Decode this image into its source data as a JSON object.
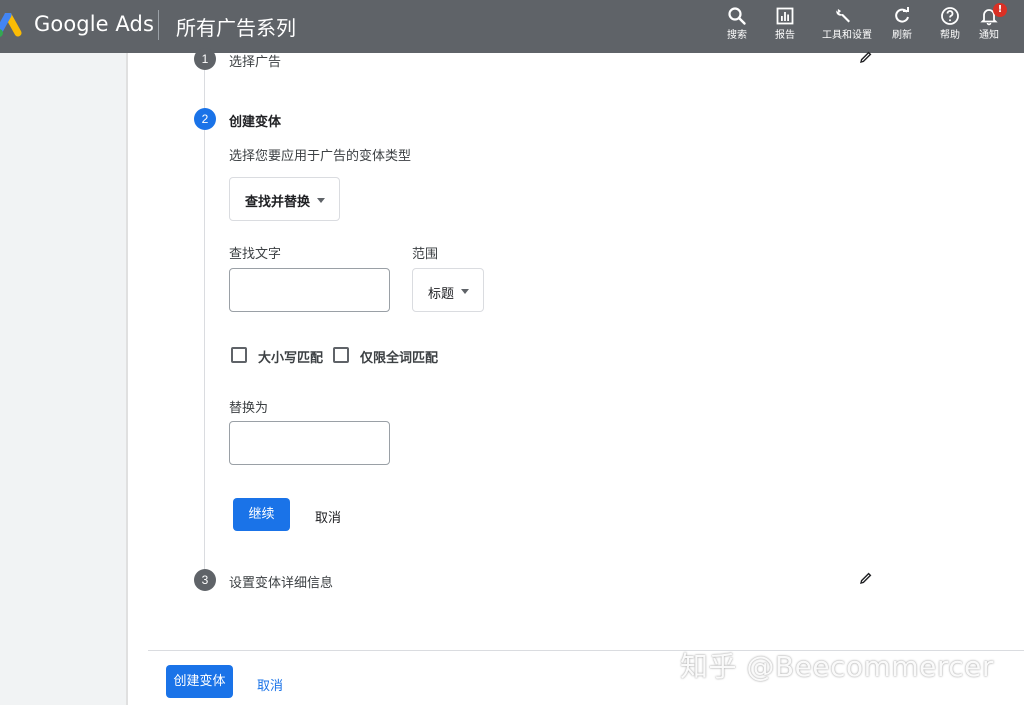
{
  "header": {
    "brand": "Google Ads",
    "title": "所有广告系列",
    "background_color": "#5f6368",
    "actions": [
      {
        "icon": "search-icon",
        "label": "搜索"
      },
      {
        "icon": "reports-icon",
        "label": "报告"
      },
      {
        "icon": "wrench-icon",
        "label": "工具和设置"
      },
      {
        "icon": "refresh-icon",
        "label": "刷新"
      },
      {
        "icon": "help-icon",
        "label": "帮助"
      },
      {
        "icon": "bell-icon",
        "label": "通知",
        "badge": "!"
      }
    ]
  },
  "stepper": {
    "steps": [
      {
        "number": "1",
        "title": "选择广告",
        "state": "completed"
      },
      {
        "number": "2",
        "title": "创建变体",
        "state": "active"
      },
      {
        "number": "3",
        "title": "设置变体详细信息",
        "state": "pending"
      }
    ]
  },
  "form": {
    "instruction": "选择您要应用于广告的变体类型",
    "variation_type": "查找并替换",
    "find_text_label": "查找文字",
    "find_text_value": "",
    "scope_label": "范围",
    "scope_value": "标题",
    "match_case_label": "大小写匹配",
    "match_case_checked": false,
    "whole_word_label": "仅限全词匹配",
    "whole_word_checked": false,
    "replace_label": "替换为",
    "replace_value": "",
    "continue_label": "继续",
    "cancel_label": "取消"
  },
  "footer": {
    "create_label": "创建变体",
    "cancel_label": "取消"
  },
  "watermark": "知乎 @Beecommercer",
  "colors": {
    "accent": "#1a73e8",
    "step_completed": "#5f6368",
    "notification_badge": "#d93025"
  }
}
